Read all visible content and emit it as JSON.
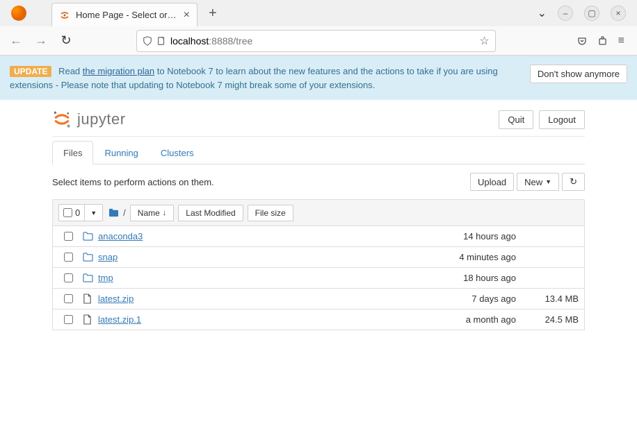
{
  "browser": {
    "tab_title": "Home Page - Select or cre",
    "url_host": "localhost",
    "url_port_path": ":8888/tree"
  },
  "banner": {
    "badge": "UPDATE",
    "pre": "Read ",
    "link": "the migration plan",
    "post1": " to Notebook 7 to learn about the new features and the actions to take if you are using extensions - Please note that updating to Notebook 7 might break some of your extensions.",
    "dismiss": "Don't show anymore"
  },
  "header": {
    "brand": "jupyter",
    "quit": "Quit",
    "logout": "Logout"
  },
  "tabs": {
    "files": "Files",
    "running": "Running",
    "clusters": "Clusters"
  },
  "toolbar": {
    "hint": "Select items to perform actions on them.",
    "upload": "Upload",
    "new": "New",
    "refresh": "⟳"
  },
  "list_head": {
    "count": "0",
    "slash": "/",
    "name_col": "Name",
    "modified_col": "Last Modified",
    "size_col": "File size"
  },
  "rows": [
    {
      "icon": "folder",
      "name": "anaconda3",
      "modified": "14 hours ago",
      "size": ""
    },
    {
      "icon": "folder",
      "name": "snap",
      "modified": "4 minutes ago",
      "size": ""
    },
    {
      "icon": "folder",
      "name": "tmp",
      "modified": "18 hours ago",
      "size": ""
    },
    {
      "icon": "file",
      "name": "latest.zip",
      "modified": "7 days ago",
      "size": "13.4 MB"
    },
    {
      "icon": "file",
      "name": "latest.zip.1",
      "modified": "a month ago",
      "size": "24.5 MB"
    }
  ]
}
